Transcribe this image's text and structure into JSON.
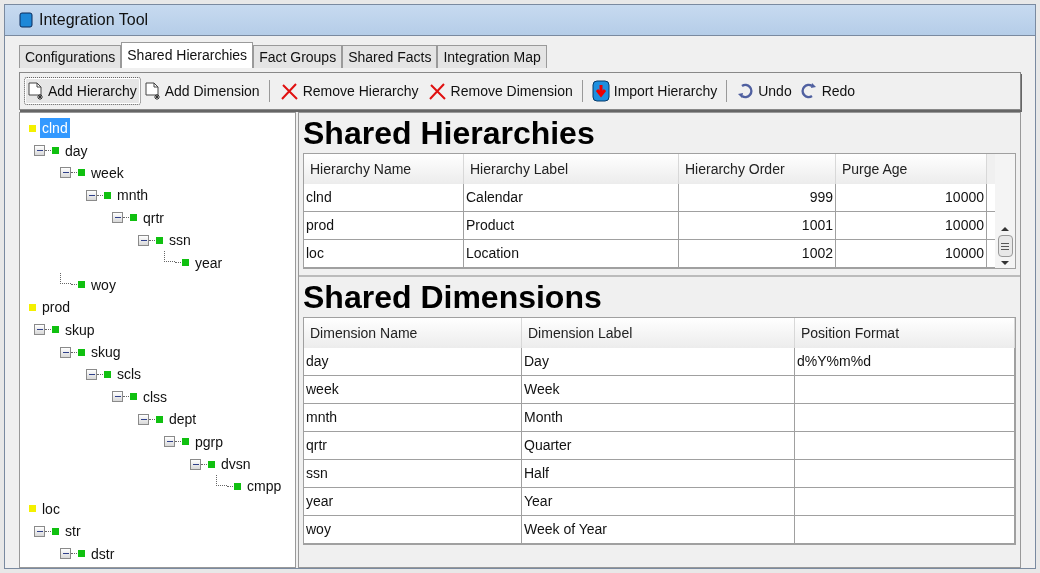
{
  "window": {
    "title": "Integration Tool"
  },
  "tabs": [
    {
      "label": "Configurations",
      "selected": false
    },
    {
      "label": "Shared Hierarchies",
      "selected": true
    },
    {
      "label": "Fact Groups",
      "selected": false
    },
    {
      "label": "Shared Facts",
      "selected": false
    },
    {
      "label": "Integration Map",
      "selected": false
    }
  ],
  "toolbar": {
    "groups": [
      [
        {
          "label": "Add Hierarchy",
          "kind": "add",
          "focused": true
        },
        {
          "label": "Add Dimension",
          "kind": "add",
          "focused": false
        }
      ],
      [
        {
          "label": "Remove Hierarchy",
          "kind": "remove",
          "focused": false
        },
        {
          "label": "Remove Dimension",
          "kind": "remove",
          "focused": false
        }
      ],
      [
        {
          "label": "Import Hierarchy",
          "kind": "import",
          "focused": false
        }
      ],
      [
        {
          "label": "Undo",
          "kind": "undo",
          "focused": false
        },
        {
          "label": "Redo",
          "kind": "redo",
          "focused": false
        }
      ]
    ]
  },
  "tree": [
    {
      "label": "clnd",
      "kind": "hierarchy",
      "selected": true,
      "children": [
        {
          "label": "day",
          "kind": "dimension",
          "selected": false,
          "expanded": true,
          "children": [
            {
              "label": "week",
              "kind": "dimension",
              "selected": false,
              "expanded": true,
              "children": [
                {
                  "label": "mnth",
                  "kind": "dimension",
                  "selected": false,
                  "expanded": true,
                  "children": [
                    {
                      "label": "qrtr",
                      "kind": "dimension",
                      "selected": false,
                      "expanded": true,
                      "children": [
                        {
                          "label": "ssn",
                          "kind": "dimension",
                          "selected": false,
                          "expanded": true,
                          "children": [
                            {
                              "label": "year",
                              "kind": "dimension",
                              "selected": false
                            }
                          ]
                        }
                      ]
                    }
                  ]
                }
              ]
            },
            {
              "label": "woy",
              "kind": "dimension",
              "selected": false
            }
          ]
        }
      ]
    },
    {
      "label": "prod",
      "kind": "hierarchy",
      "selected": false,
      "children": [
        {
          "label": "skup",
          "kind": "dimension",
          "selected": false,
          "expanded": true,
          "children": [
            {
              "label": "skug",
              "kind": "dimension",
              "selected": false,
              "expanded": true,
              "children": [
                {
                  "label": "scls",
                  "kind": "dimension",
                  "selected": false,
                  "expanded": true,
                  "children": [
                    {
                      "label": "clss",
                      "kind": "dimension",
                      "selected": false,
                      "expanded": true,
                      "children": [
                        {
                          "label": "dept",
                          "kind": "dimension",
                          "selected": false,
                          "expanded": true,
                          "children": [
                            {
                              "label": "pgrp",
                              "kind": "dimension",
                              "selected": false,
                              "expanded": true,
                              "children": [
                                {
                                  "label": "dvsn",
                                  "kind": "dimension",
                                  "selected": false,
                                  "expanded": true,
                                  "children": [
                                    {
                                      "label": "cmpp",
                                      "kind": "dimension",
                                      "selected": false
                                    }
                                  ]
                                }
                              ]
                            }
                          ]
                        }
                      ]
                    }
                  ]
                }
              ]
            }
          ]
        }
      ]
    },
    {
      "label": "loc",
      "kind": "hierarchy",
      "selected": false,
      "children": [
        {
          "label": "str",
          "kind": "dimension",
          "selected": false,
          "expanded": true,
          "children": [
            {
              "label": "dstr",
              "kind": "dimension",
              "selected": false,
              "expanded": true
            }
          ]
        }
      ]
    }
  ],
  "hierarchies": {
    "title": "Shared Hierarchies",
    "columns": [
      {
        "label": "Hierarchy Name",
        "kind": "text"
      },
      {
        "label": "Hierarchy Label",
        "kind": "text"
      },
      {
        "label": "Hierarchy Order",
        "kind": "numeric"
      },
      {
        "label": "Purge Age",
        "kind": "numeric"
      }
    ],
    "rows": [
      [
        "clnd",
        "Calendar",
        "999",
        "10000"
      ],
      [
        "prod",
        "Product",
        "1001",
        "10000"
      ],
      [
        "loc",
        "Location",
        "1002",
        "10000"
      ]
    ]
  },
  "dimensions": {
    "title": "Shared Dimensions",
    "columns": [
      {
        "label": "Dimension Name",
        "kind": "text"
      },
      {
        "label": "Dimension Label",
        "kind": "text"
      },
      {
        "label": "Position Format",
        "kind": "text"
      }
    ],
    "rows": [
      [
        "day",
        "Day",
        "d%Y%m%d"
      ],
      [
        "week",
        "Week",
        ""
      ],
      [
        "mnth",
        "Month",
        ""
      ],
      [
        "qrtr",
        "Quarter",
        ""
      ],
      [
        "ssn",
        "Half",
        ""
      ],
      [
        "year",
        "Year",
        ""
      ],
      [
        "woy",
        "Week of Year",
        ""
      ]
    ]
  }
}
